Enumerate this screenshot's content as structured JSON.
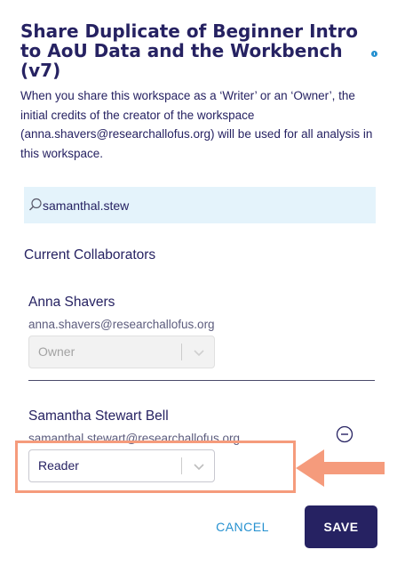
{
  "modal": {
    "title": "Share Duplicate of Beginner Intro to AoU Data and the Workbench (v7)",
    "description": "When you share this workspace as a ‘Writer’ or an ‘Owner’, the initial credits of the creator of the workspace (anna.shavers@researchallofus.org) will be used for all analysis in this workspace."
  },
  "search": {
    "value": "samanthal.stew"
  },
  "collaborators": {
    "section_label": "Current Collaborators",
    "items": [
      {
        "name": "Anna Shavers",
        "email": "anna.shavers@researchallofus.org",
        "role": "Owner",
        "disabled": true
      },
      {
        "name": "Samantha Stewart Bell",
        "email": "samanthal.stewart@researchallofus.org",
        "role": "Reader",
        "disabled": false
      }
    ]
  },
  "footer": {
    "cancel_label": "CANCEL",
    "save_label": "SAVE"
  },
  "icons": [
    "info-icon",
    "search-icon",
    "chevron-down-icon",
    "remove-circle-icon",
    "arrow-left-icon"
  ],
  "colors": {
    "primary": "#262262",
    "accent": "#2691d0",
    "search_bg": "#e4f3fb",
    "highlight": "#f59b7c"
  }
}
